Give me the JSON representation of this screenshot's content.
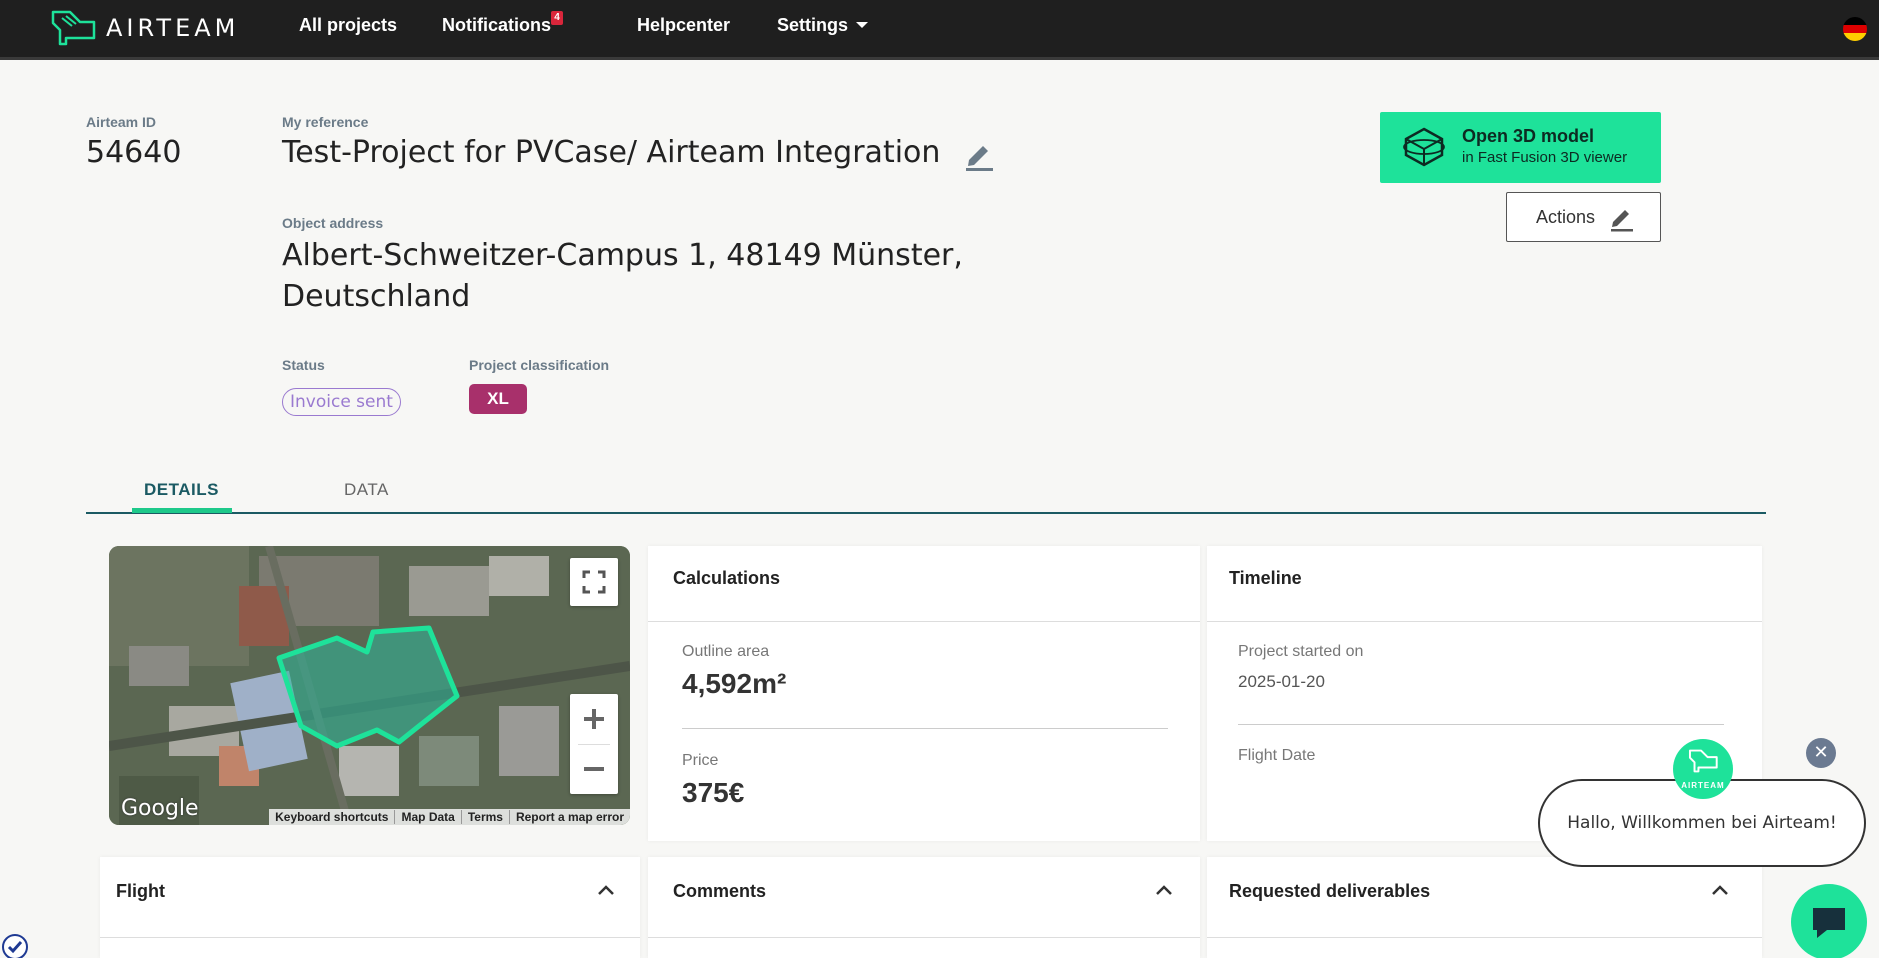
{
  "nav": {
    "brand": "AIRTEAM",
    "items": [
      "All projects",
      "Notifications",
      "Helpcenter",
      "Settings"
    ],
    "notifications_count": "4",
    "flag": "german-flag-icon"
  },
  "project": {
    "airteam_id_label": "Airteam ID",
    "airteam_id": "54640",
    "reference_label": "My reference",
    "reference": "Test-Project for PVCase/ Airteam Integration",
    "address_label": "Object address",
    "address": "Albert-Schweitzer-Campus 1, 48149 Münster, Deutschland",
    "status_label": "Status",
    "status": "Invoice sent",
    "classification_label": "Project classification",
    "classification": "XL"
  },
  "buttons": {
    "open_3d_title": "Open 3D model",
    "open_3d_sub": "in Fast Fusion 3D viewer",
    "actions": "Actions"
  },
  "tabs": [
    "DETAILS",
    "DATA"
  ],
  "map": {
    "google": "Google",
    "footer": [
      "Keyboard shortcuts",
      "Map Data",
      "Terms",
      "Report a map error"
    ]
  },
  "calculations": {
    "title": "Calculations",
    "outline_area_label": "Outline area",
    "outline_area": "4,592m²",
    "price_label": "Price",
    "price": "375€"
  },
  "timeline": {
    "title": "Timeline",
    "started_label": "Project started on",
    "started": "2025-01-20",
    "flight_date_label": "Flight Date"
  },
  "sections": {
    "flight": "Flight",
    "comments": "Comments",
    "deliverables": "Requested deliverables"
  },
  "chat": {
    "greeting": "Hallo, Willkommen bei Airteam!",
    "avatar_label": "AIRTEAM"
  },
  "colors": {
    "accent": "#1ee29a",
    "nav_bg": "#1f1f1f",
    "status": "#9a7ad0",
    "classification": "#a8306b",
    "tab_active": "#1b5a63"
  }
}
